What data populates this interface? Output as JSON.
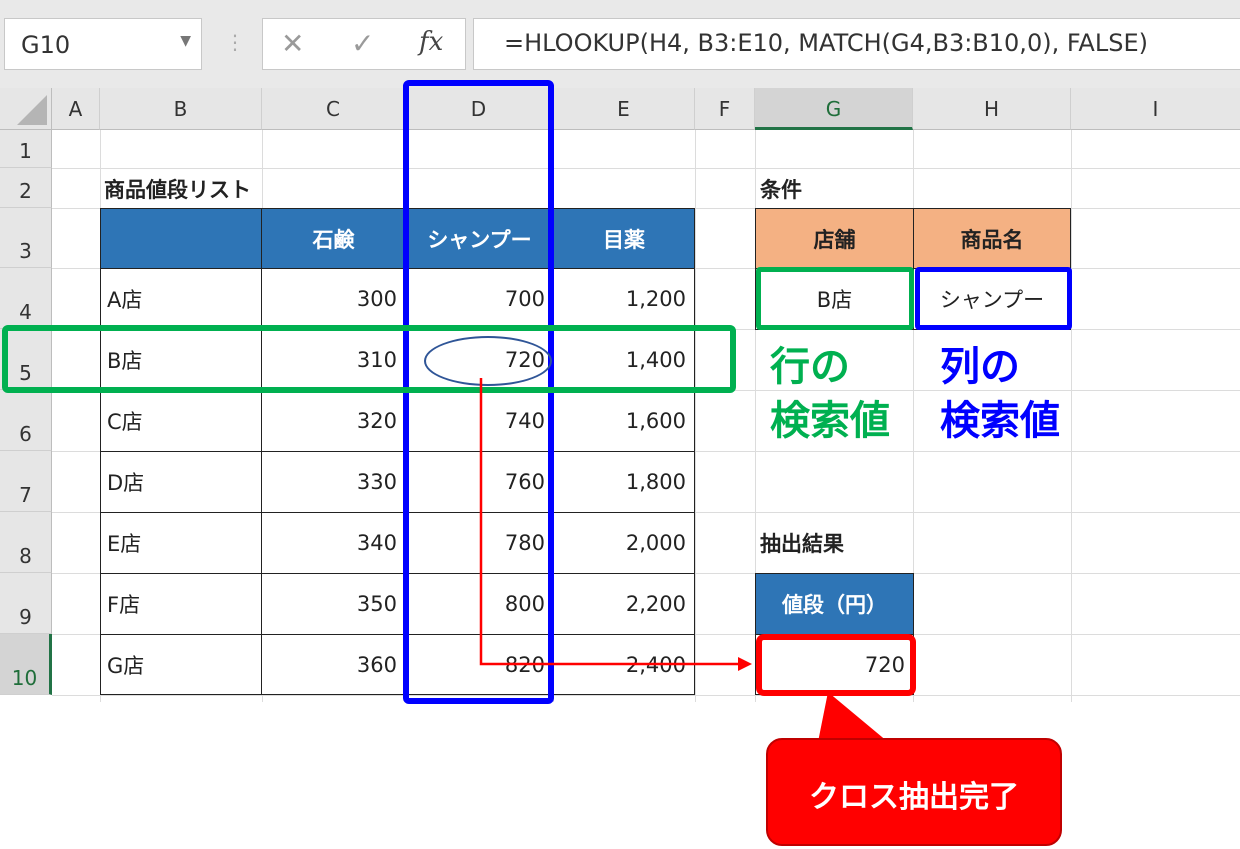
{
  "formula_bar": {
    "name_box": "G10",
    "cancel_icon": "✕",
    "enter_icon": "✓",
    "fx_label": "fx",
    "formula": "=HLOOKUP(H4, B3:E10, MATCH(G4,B3:B10,0), FALSE)"
  },
  "columns": [
    "A",
    "B",
    "C",
    "D",
    "E",
    "F",
    "G",
    "H",
    "I"
  ],
  "rows": [
    "1",
    "2",
    "3",
    "4",
    "5",
    "6",
    "7",
    "8",
    "9",
    "10"
  ],
  "active_cell": "G10",
  "table": {
    "title": "商品値段リスト",
    "headers": [
      "",
      "石鹸",
      "シャンプー",
      "目薬"
    ],
    "rows": [
      [
        "A店",
        "300",
        "700",
        "1,200"
      ],
      [
        "B店",
        "310",
        "720",
        "1,400"
      ],
      [
        "C店",
        "320",
        "740",
        "1,600"
      ],
      [
        "D店",
        "330",
        "760",
        "1,800"
      ],
      [
        "E店",
        "340",
        "780",
        "2,000"
      ],
      [
        "F店",
        "350",
        "800",
        "2,200"
      ],
      [
        "G店",
        "360",
        "820",
        "2,400"
      ]
    ]
  },
  "conditions": {
    "title": "条件",
    "headers": [
      "店舗",
      "商品名"
    ],
    "store_value": "B店",
    "product_value": "シャンプー"
  },
  "result": {
    "title": "抽出結果",
    "header": "値段（円）",
    "value": "720"
  },
  "annotations": {
    "row_lookup_line1": "行の",
    "row_lookup_line2": "検索値",
    "col_lookup_line1": "列の",
    "col_lookup_line2": "検索値",
    "callout": "クロス抽出完了"
  },
  "colors": {
    "green": "#00b050",
    "blue": "#0000ff",
    "red": "#ff0000",
    "table_header_blue": "#2e75b6",
    "condition_header_orange": "#f4b183"
  }
}
